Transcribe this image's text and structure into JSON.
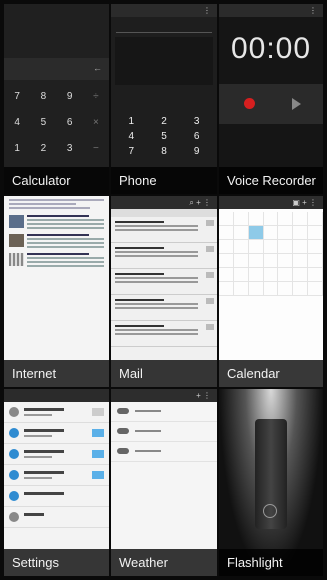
{
  "tiles": {
    "calculator": {
      "label": "Calculator"
    },
    "phone": {
      "label": "Phone"
    },
    "voice_recorder": {
      "label": "Voice Recorder",
      "time": "00:00"
    },
    "internet": {
      "label": "Internet"
    },
    "mail": {
      "label": "Mail"
    },
    "calendar": {
      "label": "Calendar"
    },
    "settings": {
      "label": "Settings"
    },
    "weather": {
      "label": "Weather"
    },
    "flashlight": {
      "label": "Flashlight"
    }
  },
  "calculator_keys": [
    "7",
    "8",
    "9",
    "÷",
    "4",
    "5",
    "6",
    "×",
    "1",
    "2",
    "3",
    "−"
  ],
  "phone_keys": [
    "1",
    "2",
    "3",
    "4",
    "5",
    "6",
    "7",
    "8",
    "9"
  ],
  "colors": {
    "record": "#d61f1f",
    "selected_day": "#8ecae8",
    "settings_icon": "#2e8bd1"
  }
}
